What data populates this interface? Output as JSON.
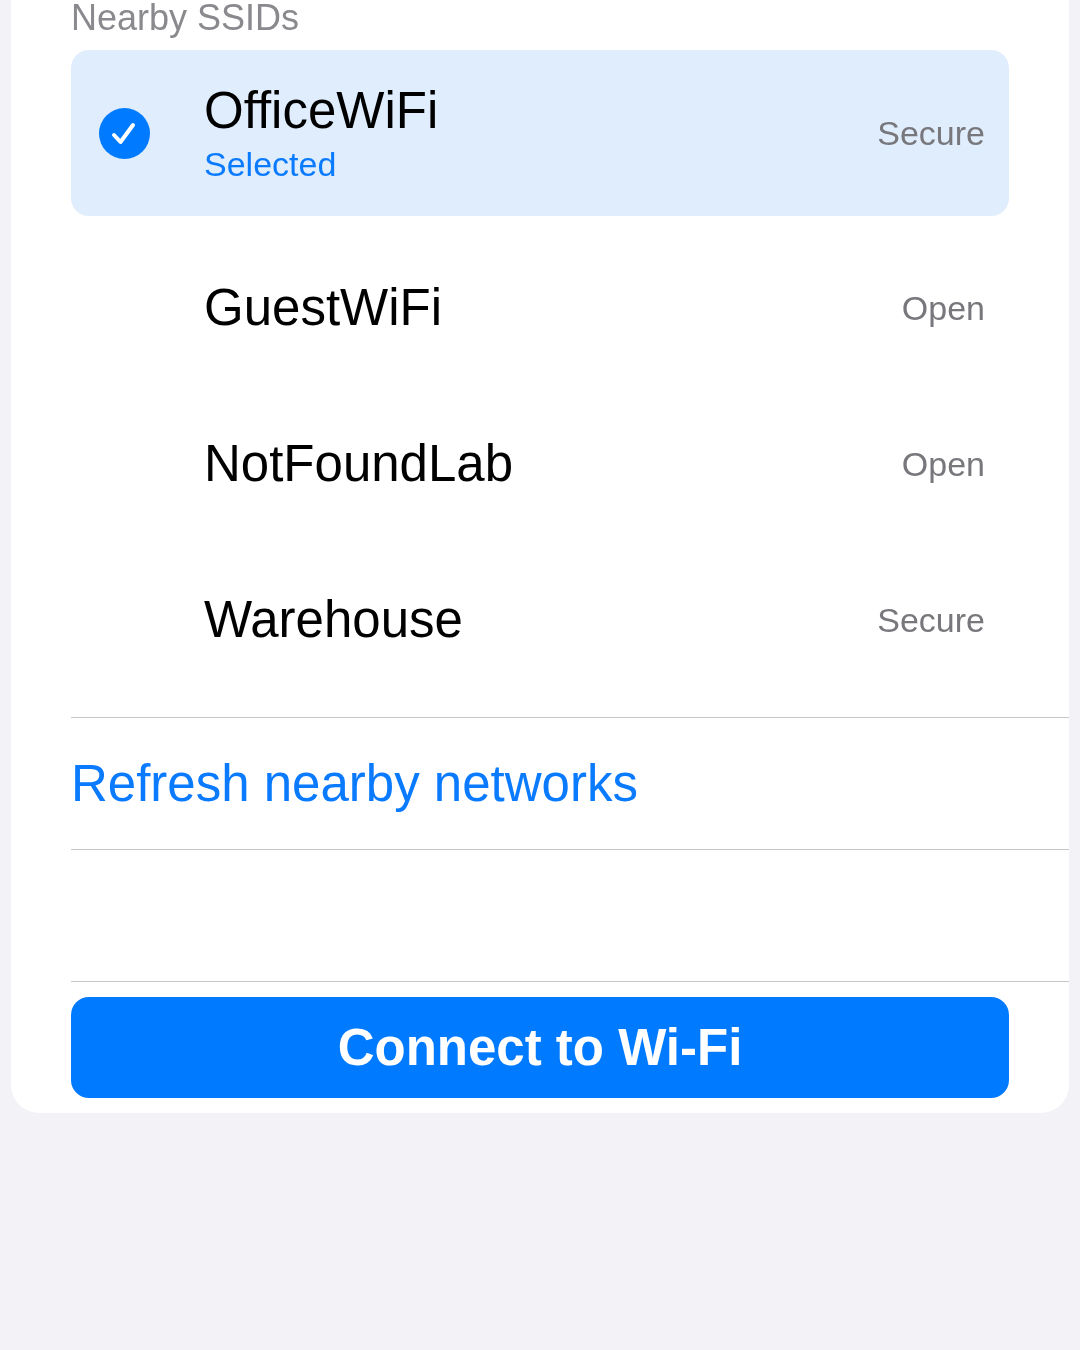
{
  "section_header": "Nearby SSIDs",
  "networks": [
    {
      "name": "OfficeWiFi",
      "selected": true,
      "note": "Selected",
      "security": "Secure"
    },
    {
      "name": "GuestWiFi",
      "selected": false,
      "security": "Open"
    },
    {
      "name": "NotFoundLab",
      "selected": false,
      "security": "Open"
    },
    {
      "name": "Warehouse",
      "selected": false,
      "security": "Secure"
    }
  ],
  "refresh_link": "Refresh nearby networks",
  "connect_button": "Connect to Wi-Fi"
}
